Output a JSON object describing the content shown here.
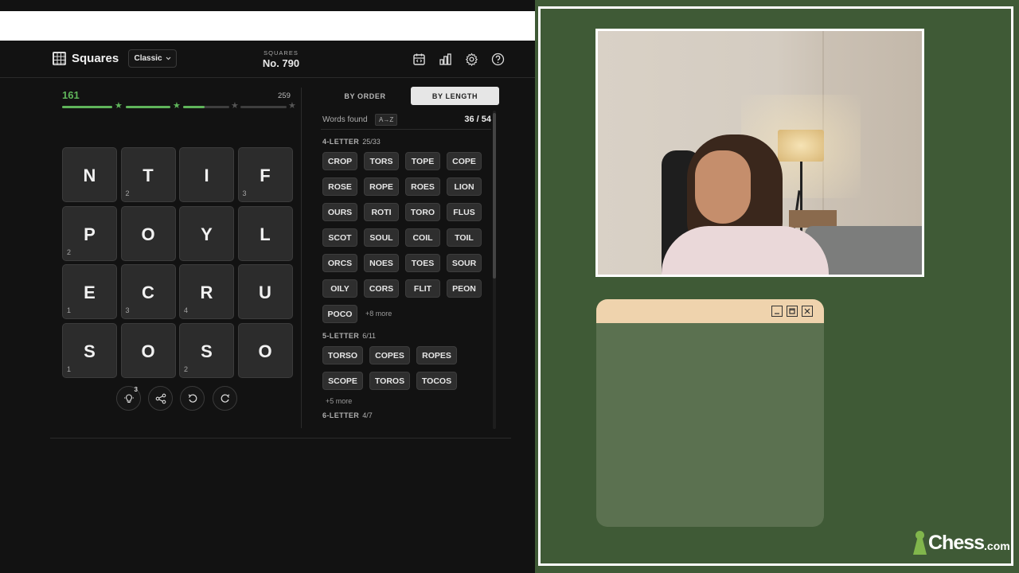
{
  "header": {
    "app_title": "Squares",
    "mode_label": "Classic",
    "puzzle_label": "SQUARES",
    "puzzle_number": "No. 790"
  },
  "score": {
    "current": "161",
    "max": "259",
    "progress_fraction": 0.622
  },
  "board": {
    "tiles": [
      {
        "letter": "N",
        "count": ""
      },
      {
        "letter": "T",
        "count": "2"
      },
      {
        "letter": "I",
        "count": ""
      },
      {
        "letter": "F",
        "count": "3"
      },
      {
        "letter": "P",
        "count": "2"
      },
      {
        "letter": "O",
        "count": ""
      },
      {
        "letter": "Y",
        "count": ""
      },
      {
        "letter": "L",
        "count": ""
      },
      {
        "letter": "E",
        "count": "1"
      },
      {
        "letter": "C",
        "count": "3"
      },
      {
        "letter": "R",
        "count": "4"
      },
      {
        "letter": "U",
        "count": ""
      },
      {
        "letter": "S",
        "count": "1"
      },
      {
        "letter": "O",
        "count": ""
      },
      {
        "letter": "S",
        "count": "2"
      },
      {
        "letter": "O",
        "count": ""
      }
    ]
  },
  "tools": {
    "hint_badge": "3"
  },
  "tabs": {
    "by_order": "BY ORDER",
    "by_length": "BY LENGTH"
  },
  "words": {
    "found_label": "Words found",
    "sort_label": "A→Z",
    "found_count": "36 / 54",
    "groups": [
      {
        "title": "4-LETTER",
        "count": "25/33",
        "words": [
          "CROP",
          "TORS",
          "TOPE",
          "COPE",
          "ROSE",
          "ROPE",
          "ROES",
          "LION",
          "OURS",
          "ROTI",
          "TORO",
          "FLUS",
          "SCOT",
          "SOUL",
          "COIL",
          "TOIL",
          "ORCS",
          "NOES",
          "TOES",
          "SOUR",
          "OILY",
          "CORS",
          "FLIT",
          "PEON",
          "POCO"
        ],
        "more": "+8 more"
      },
      {
        "title": "5-LETTER",
        "count": "6/11",
        "words": [
          "TORSO",
          "COPES",
          "ROPES",
          "SCOPE",
          "TOROS",
          "TOCOS"
        ],
        "more": "+5 more"
      },
      {
        "title": "6-LETTER",
        "count": "4/7",
        "words": [],
        "more": ""
      }
    ]
  },
  "overlay": {
    "brand": "Chess",
    "brand_suffix": ".com",
    "bg_color": "#3f5a36",
    "accent_color": "#81b64c"
  },
  "icons": [
    "grid-icon",
    "chevron-down-icon",
    "calendar-icon",
    "stats-icon",
    "gear-icon",
    "help-icon",
    "lightbulb-icon",
    "share-icon",
    "undo-icon",
    "redo-icon",
    "star-icon",
    "minimize-icon",
    "maximize-icon",
    "close-icon"
  ]
}
